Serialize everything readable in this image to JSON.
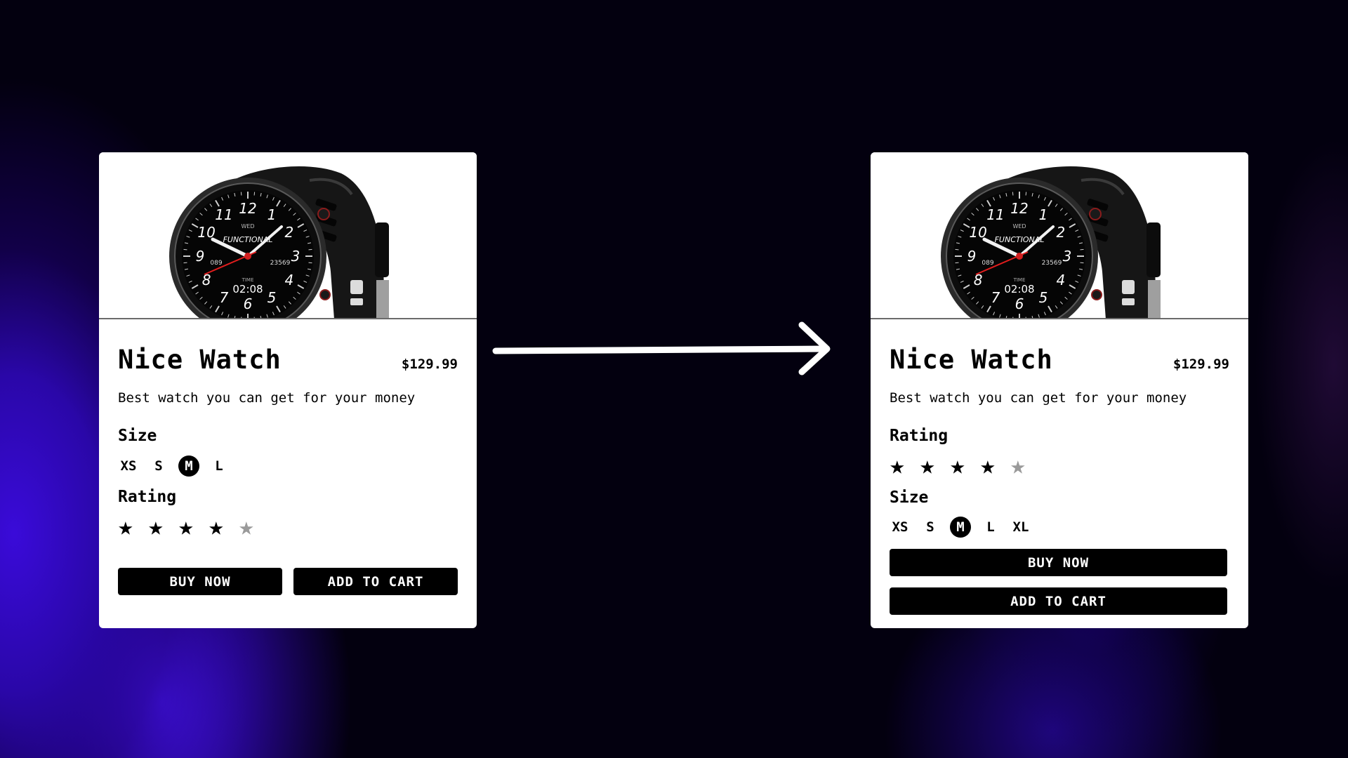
{
  "cards": [
    {
      "id": "before",
      "product_title": "Nice Watch",
      "price": "$129.99",
      "description": "Best watch you can get for your money",
      "size_label": "Size",
      "sizes": [
        "XS",
        "S",
        "M",
        "L"
      ],
      "selected_size": "M",
      "rating_label": "Rating",
      "rating": 4,
      "rating_max": 5,
      "buy_label": "BUY NOW",
      "cart_label": "ADD TO CART"
    },
    {
      "id": "after",
      "product_title": "Nice Watch",
      "price": "$129.99",
      "description": "Best watch you can get for your money",
      "size_label": "Size",
      "sizes": [
        "XS",
        "S",
        "M",
        "L",
        "XL"
      ],
      "selected_size": "M",
      "rating_label": "Rating",
      "rating": 4,
      "rating_max": 5,
      "buy_label": "BUY NOW",
      "cart_label": "ADD TO CART"
    }
  ],
  "watch_face": {
    "brand": "FUNCTIONAL",
    "time": "02:08",
    "time_label": "TIME",
    "steps": "23569",
    "heart": "089",
    "day": "WED"
  },
  "colors": {
    "background": "#03000f",
    "glow": "#3a0bd9",
    "card": "#ffffff",
    "button": "#000000",
    "star_dim": "#9a9a9a",
    "second_hand": "#e11d1d"
  },
  "icons": {
    "arrow": "arrow-right-icon",
    "star": "star-icon"
  }
}
